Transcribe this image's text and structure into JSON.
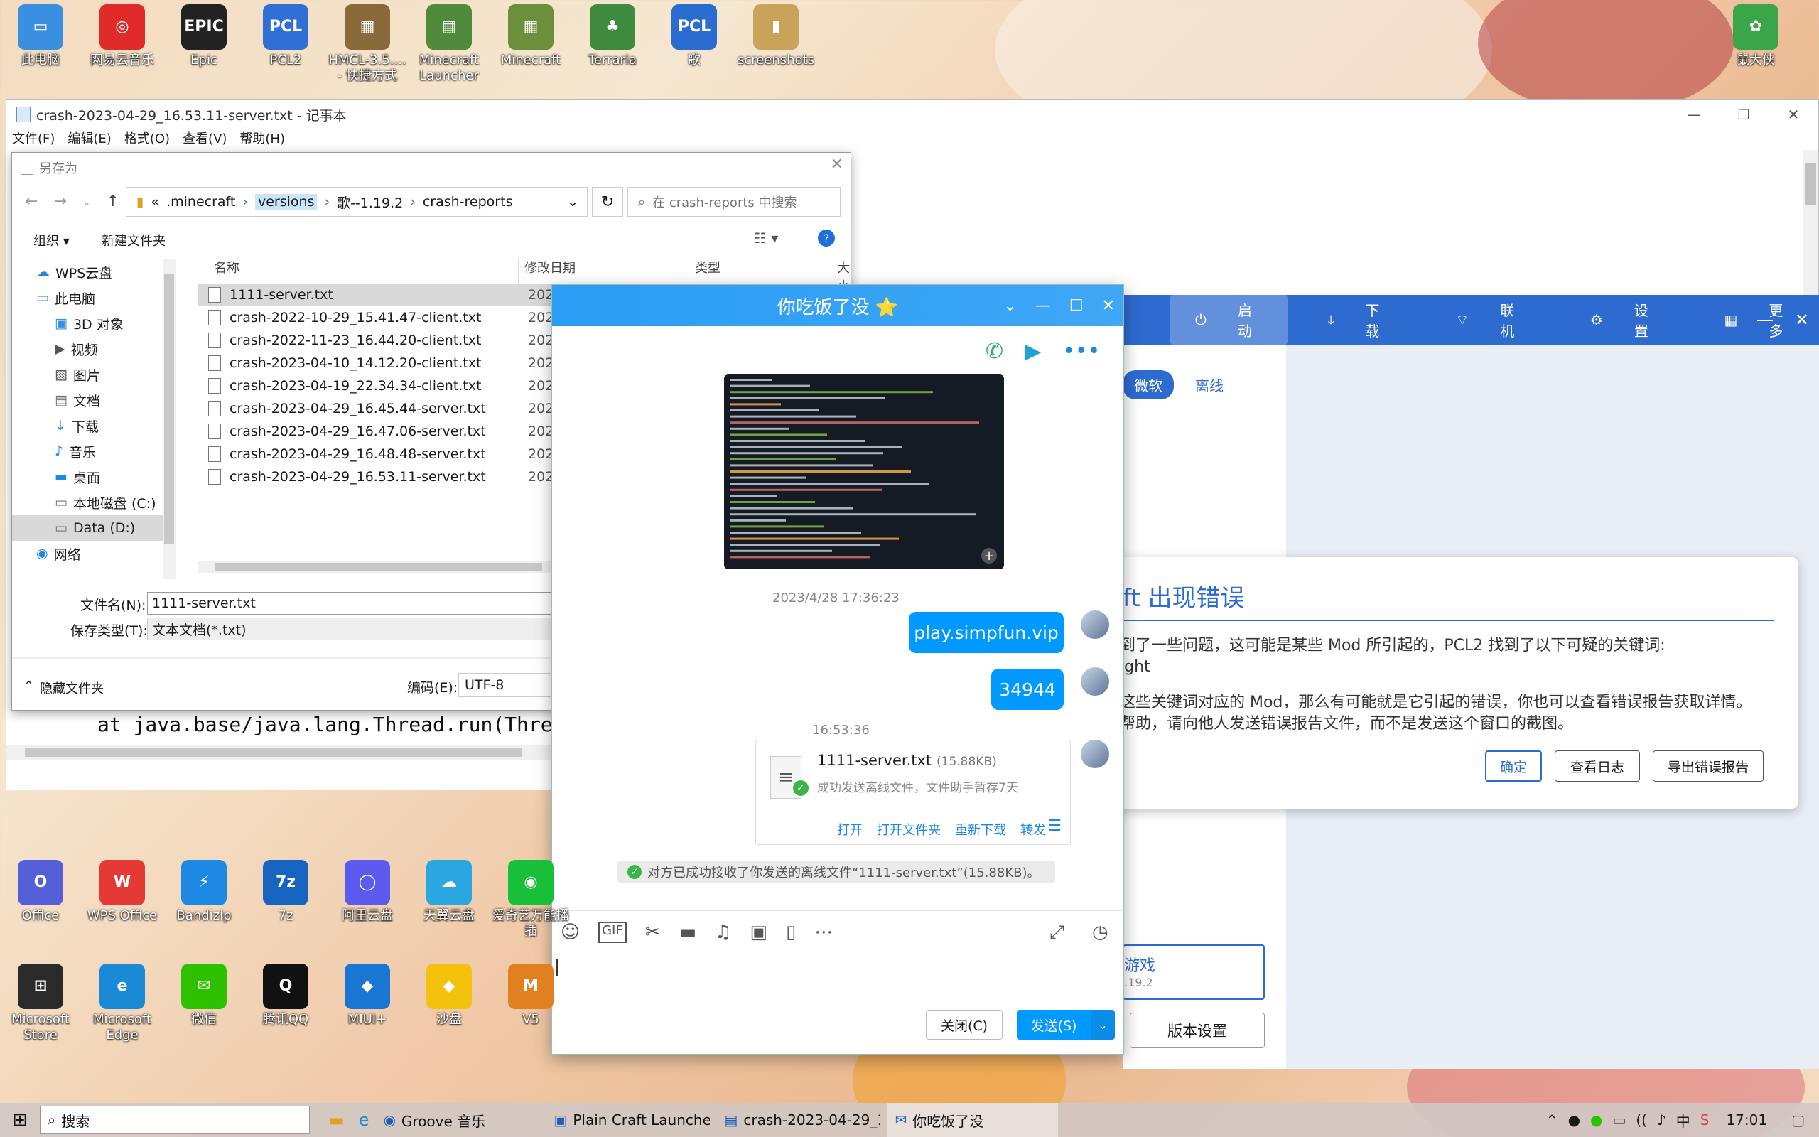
{
  "desktop_top": [
    {
      "label": "此电脑",
      "color": "#3b8fe0",
      "glyph": "▭",
      "icon": "computer-icon"
    },
    {
      "label": "网易云音乐",
      "color": "#e12a2a",
      "glyph": "◎",
      "icon": "netease-music-icon"
    },
    {
      "label": "Epic",
      "color": "#222",
      "glyph": "EPIC",
      "icon": "epic-games-icon"
    },
    {
      "label": "PCL2",
      "color": "#2f6fd6",
      "glyph": "PCL",
      "icon": "pcl2-icon"
    },
    {
      "label": "HMCL-3.5....\n- 快捷方式",
      "color": "#8a6a3a",
      "glyph": "▦",
      "icon": "hmcl-icon"
    },
    {
      "label": "Minecraft\nLauncher",
      "color": "#4f8b3a",
      "glyph": "▦",
      "icon": "minecraft-launcher-icon"
    },
    {
      "label": "Minecraft",
      "color": "#6b8f3a",
      "glyph": "▦",
      "icon": "minecraft-icon"
    },
    {
      "label": "Terraria",
      "color": "#3e8a3e",
      "glyph": "♣",
      "icon": "terraria-icon"
    },
    {
      "label": "歌",
      "color": "#2a6cd0",
      "glyph": "PCL",
      "icon": "pcl-folder-icon"
    },
    {
      "label": "screenshots",
      "color": "#c9a35a",
      "glyph": "▮",
      "icon": "folder-icon"
    }
  ],
  "desktop_right": {
    "label": "鼠大侠",
    "color": "#3ba54a",
    "glyph": "✿",
    "icon": "shudaxia-icon"
  },
  "desktop_bottom_row1": [
    {
      "label": "Office",
      "color": "#5560d8",
      "glyph": "O",
      "icon": "office-icon"
    },
    {
      "label": "WPS Office",
      "color": "#e53935",
      "glyph": "W",
      "icon": "wps-office-icon"
    },
    {
      "label": "Bandizip",
      "color": "#1e88e5",
      "glyph": "⚡",
      "icon": "bandizip-icon"
    },
    {
      "label": "7z",
      "color": "#1565c0",
      "glyph": "7z",
      "icon": "7zip-icon"
    },
    {
      "label": "阿里云盘",
      "color": "#5b5bf0",
      "glyph": "◯",
      "icon": "aliyun-drive-icon"
    },
    {
      "label": "天翼云盘",
      "color": "#2aa7e0",
      "glyph": "☁",
      "icon": "tianyi-cloud-icon"
    },
    {
      "label": "爱奇艺万能播\n插",
      "color": "#18c03a",
      "glyph": "◉",
      "icon": "iqiyi-icon"
    }
  ],
  "desktop_bottom_row2": [
    {
      "label": "Microsoft\nStore",
      "color": "#2b2b2b",
      "glyph": "⊞",
      "icon": "microsoft-store-icon"
    },
    {
      "label": "Microsoft\nEdge",
      "color": "#1b8ad6",
      "glyph": "e",
      "icon": "edge-icon"
    },
    {
      "label": "微信",
      "color": "#2dc100",
      "glyph": "✉",
      "icon": "wechat-icon"
    },
    {
      "label": "腾讯QQ",
      "color": "#111",
      "glyph": "Q",
      "icon": "qq-icon"
    },
    {
      "label": "MIUI+",
      "color": "#1976d2",
      "glyph": "◆",
      "icon": "miui-icon"
    },
    {
      "label": "沙盘",
      "color": "#f4c20d",
      "glyph": "◆",
      "icon": "sandbox-icon"
    },
    {
      "label": "V5",
      "color": "#e0801f",
      "glyph": "M",
      "icon": "v5-icon"
    }
  ],
  "notepad": {
    "title": "crash-2023-04-29_16.53.11-server.txt - 记事本",
    "menu": [
      "文件(F)",
      "编辑(E)",
      "格式(O)",
      "查看(V)",
      "帮助(H)"
    ],
    "code_line": "at java.base/java.lang.Thread.run(Thread"
  },
  "saveas": {
    "title": "另存为",
    "breadcrumb": [
      "«",
      ".minecraft",
      "versions",
      "歌--1.19.2",
      "crash-reports"
    ],
    "search_placeholder": "在 crash-reports 中搜索",
    "organize": "组织 ▾",
    "new_folder": "新建文件夹",
    "tree": [
      "WPS云盘",
      "此电脑",
      "3D 对象",
      "视频",
      "图片",
      "文档",
      "下载",
      "音乐",
      "桌面",
      "本地磁盘 (C:)",
      "Data (D:)",
      "网络"
    ],
    "col_name": "名称",
    "col_date": "修改日期",
    "col_type": "类型",
    "col_size": "大小",
    "files": [
      {
        "name": "1111-server.txt",
        "date": "2023/"
      },
      {
        "name": "crash-2022-10-29_15.41.47-client.txt",
        "date": "2022/"
      },
      {
        "name": "crash-2022-11-23_16.44.20-client.txt",
        "date": "2022/"
      },
      {
        "name": "crash-2023-04-10_14.12.20-client.txt",
        "date": "2023/"
      },
      {
        "name": "crash-2023-04-19_22.34.34-client.txt",
        "date": "2023/"
      },
      {
        "name": "crash-2023-04-29_16.45.44-server.txt",
        "date": "2023/"
      },
      {
        "name": "crash-2023-04-29_16.47.06-server.txt",
        "date": "2023/"
      },
      {
        "name": "crash-2023-04-29_16.48.48-server.txt",
        "date": "2023/"
      },
      {
        "name": "crash-2023-04-29_16.53.11-server.txt",
        "date": "2023/"
      }
    ],
    "filename_label": "文件名(N):",
    "filename_value": "1111-server.txt",
    "type_label": "保存类型(T):",
    "type_value": "文本文档(*.txt)",
    "hide_folders": "隐藏文件夹",
    "encoding_label": "编码(E):",
    "encoding_value": "UTF-8"
  },
  "qq": {
    "title": "你吃饭了没 ⭐",
    "time1": "2023/4/28 17:36:23",
    "msg1": "play.simpfun.vip",
    "msg2": "34944",
    "time2": "16:53:36",
    "file_name": "1111-server.txt",
    "file_size": "(15.88KB)",
    "file_status": "成功发送离线文件，文件助手暂存7天",
    "file_actions": [
      "打开",
      "打开文件夹",
      "重新下载",
      "转发"
    ],
    "notice": "对方已成功接收了你发送的离线文件“1111-server.txt”(15.88KB)。",
    "close_btn": "关闭(C)",
    "send_btn": "发送(S)"
  },
  "pcl": {
    "nav": [
      "启动",
      "下载",
      "联机",
      "设置",
      "更多"
    ],
    "account_tabs": [
      "微软",
      "离线"
    ],
    "err_title": "ft 出现错误",
    "err_line1": "到了一些问题，这可能是某些 Mod 所引起的，PCL2 找到了以下可疑的关键词:",
    "err_line2": "ight",
    "err_line3": "这些关键词对应的 Mod，那么有可能就是它引起的错误，你也可以查看错误报告获取详情。",
    "err_line4": "帮助，请向他人发送错误报告文件，而不是发送这个窗口的截图。",
    "btn_ok": "确定",
    "btn_log": "查看日志",
    "btn_export": "导出错误报告",
    "game_btn": "游戏",
    "game_ver": ".19.2",
    "version_settings": "版本设置"
  },
  "taskbar": {
    "search": "搜索",
    "apps": [
      "Groove 音乐",
      "Plain Craft Launcher...",
      "crash-2023-04-29_1...",
      "你吃饭了没"
    ],
    "ime": "中",
    "clock": "17:01"
  }
}
